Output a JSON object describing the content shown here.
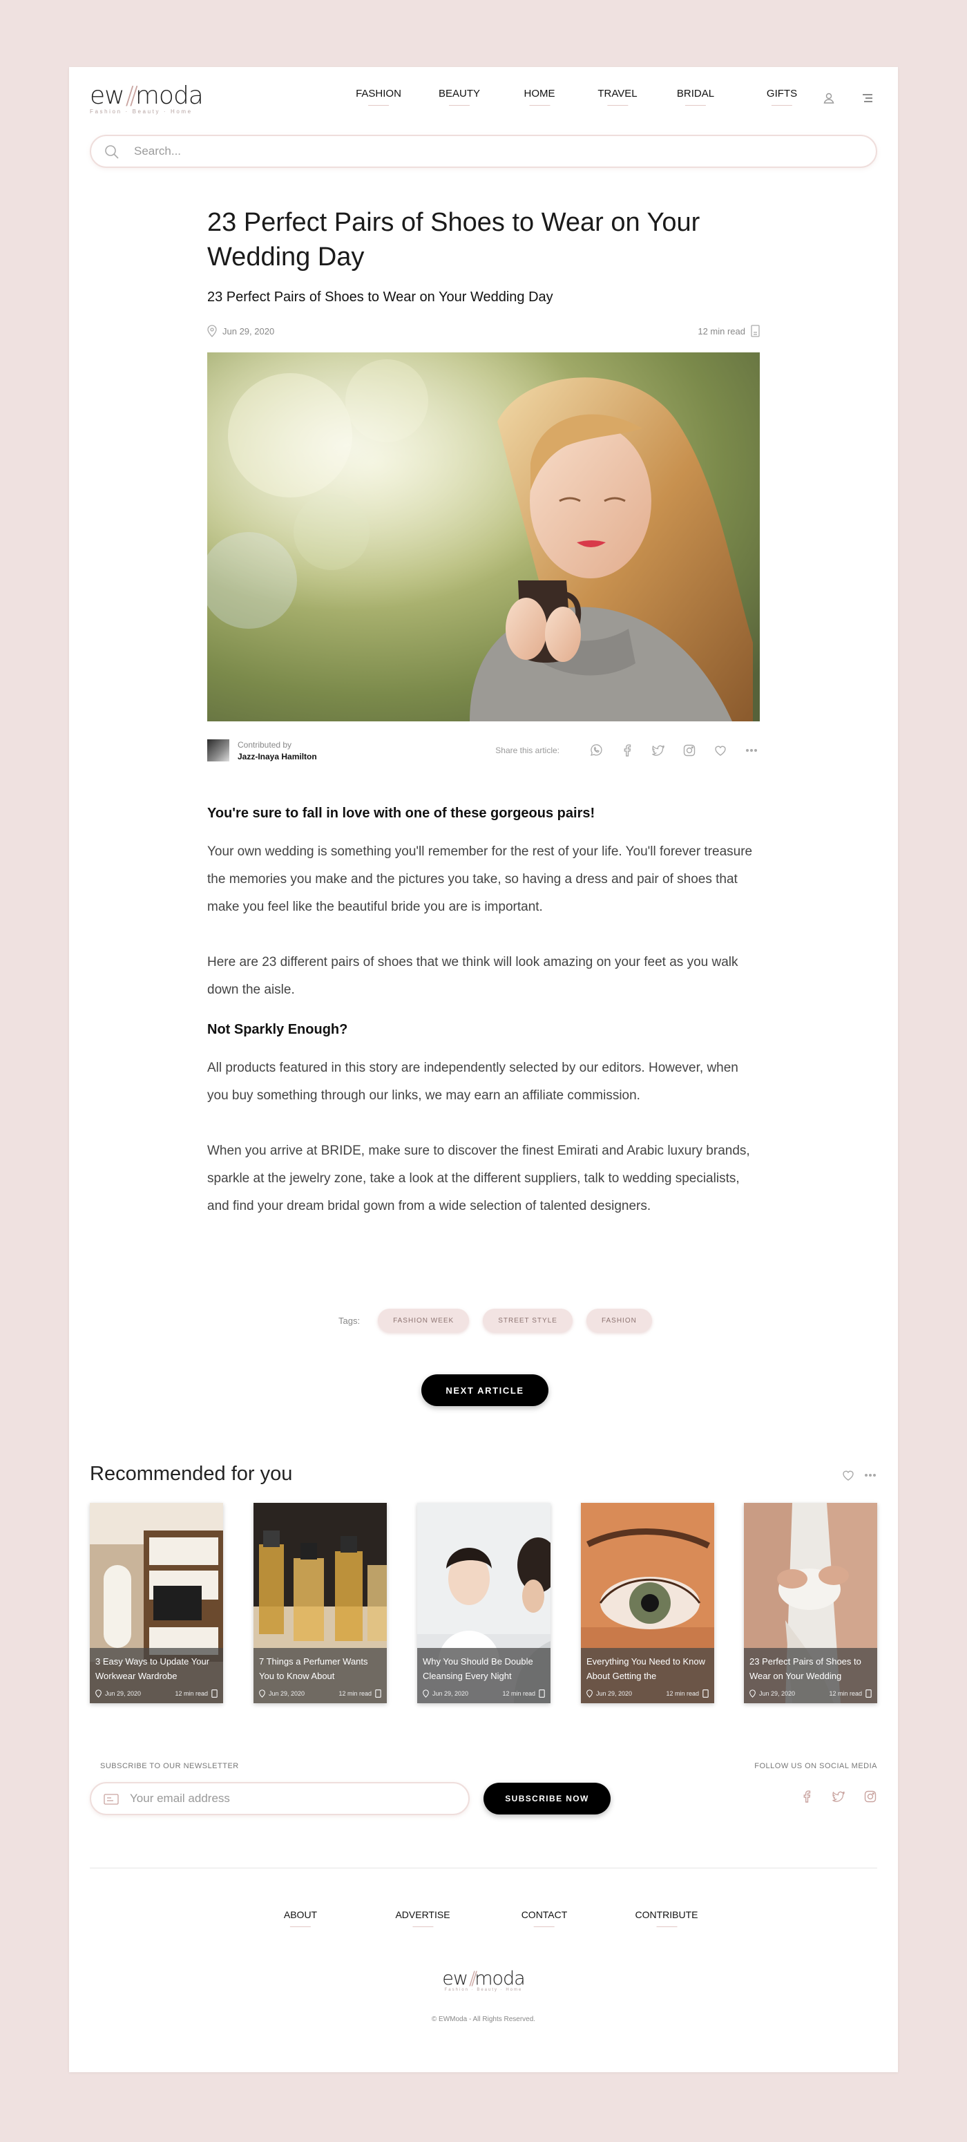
{
  "header": {
    "logo_main_left": "ew",
    "logo_main_right": "moda",
    "logo_tagline": "Fashion · Beauty · Home",
    "nav": [
      {
        "label": "FASHION"
      },
      {
        "label": "BEAUTY"
      },
      {
        "label": "HOME"
      },
      {
        "label": "TRAVEL"
      },
      {
        "label": "BRIDAL"
      },
      {
        "label": "GIFTS"
      }
    ],
    "icons": [
      "user-icon",
      "menu-icon"
    ]
  },
  "search": {
    "placeholder": "Search...",
    "value": ""
  },
  "article": {
    "title": "23 Perfect Pairs of Shoes to Wear on Your Wedding Day",
    "subtitle": "23 Perfect Pairs of Shoes to Wear on Your Wedding Day",
    "date": "Jun 29, 2020",
    "read_time": "12 min read",
    "contributor_label": "Contributed by",
    "contributor_name": "Jazz-Inaya Hamilton",
    "share_label": "Share this article:",
    "share_icons": [
      "whatsapp-icon",
      "facebook-icon",
      "twitter-icon",
      "instagram-icon",
      "heart-icon",
      "more-icon"
    ],
    "lead": "You're sure to fall in love with one of these gorgeous pairs!",
    "paragraph_1": "Your own wedding is something you'll remember for the rest of your life. You'll forever treasure the memories you make and the pictures you take, so having a dress and pair of shoes that make you feel like the beautiful bride you are is important.",
    "paragraph_2": "Here are 23 different pairs of shoes that we think will look amazing on your feet as you walk down the aisle.",
    "heading_2": "Not Sparkly Enough?",
    "paragraph_3": "All products featured in this story are independently selected by our editors. However, when you buy something through our links, we may earn an affiliate commission.",
    "paragraph_4": "When you arrive at BRIDE, make sure to discover the finest Emirati and Arabic luxury brands, sparkle at the jewelry zone, take a look at the different suppliers, talk to wedding specialists, and find your dream bridal gown from a wide selection of talented designers.",
    "tags_label": "Tags:",
    "tags": [
      "FASHION WEEK",
      "STREET STYLE",
      "FASHION"
    ],
    "next_label": "NEXT ARTICLE"
  },
  "recommended": {
    "title": "Recommended for you",
    "cards": [
      {
        "title": "3 Easy Ways to Update Your Workwear Wardrobe",
        "date": "Jun 29, 2020",
        "read": "12 min read"
      },
      {
        "title": "7 Things a Perfumer Wants You to Know About",
        "date": "Jun 29, 2020",
        "read": "12 min read"
      },
      {
        "title": "Why You Should Be Double Cleansing Every Night",
        "date": "Jun 29, 2020",
        "read": "12 min read"
      },
      {
        "title": "Everything You Need to Know About Getting the",
        "date": "Jun 29, 2020",
        "read": "12 min read"
      },
      {
        "title": "23 Perfect Pairs of Shoes to Wear on Your Wedding",
        "date": "Jun 29, 2020",
        "read": "12 min read"
      }
    ]
  },
  "newsletter": {
    "label": "SUBSCRIBE TO OUR NEWSLETTER",
    "placeholder": "Your email address",
    "button": "SUBSCRIBE NOW"
  },
  "social": {
    "label": "FOLLOW US ON SOCIAL MEDIA",
    "icons": [
      "facebook-icon",
      "twitter-icon",
      "instagram-icon"
    ]
  },
  "footer": {
    "nav": [
      {
        "label": "ABOUT"
      },
      {
        "label": "ADVERTISE"
      },
      {
        "label": "CONTACT"
      },
      {
        "label": "CONTRIBUTE"
      }
    ],
    "copyright": "© EWModa - All Rights Reserved."
  },
  "colors": {
    "background": "#efe1e0",
    "accent": "#c9a4a0",
    "tag_bg": "#f2e3e2",
    "button": "#000000"
  }
}
